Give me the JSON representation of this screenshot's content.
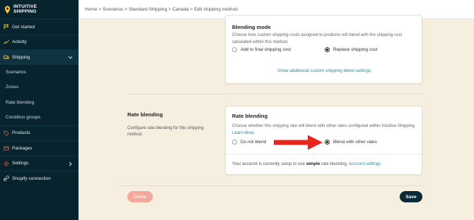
{
  "brand": {
    "line1": "INTUITIVE",
    "line2": "SHIPPING",
    "accent": "#f5c42a"
  },
  "sidebar": {
    "items": [
      {
        "label": "Get started",
        "icon": "flag-icon"
      },
      {
        "label": "Activity",
        "icon": "activity-icon"
      },
      {
        "label": "Shipping",
        "icon": "truck-icon"
      },
      {
        "label": "Scenarios"
      },
      {
        "label": "Zones"
      },
      {
        "label": "Rate blending"
      },
      {
        "label": "Condition groups"
      },
      {
        "label": "Products",
        "icon": "tag-icon"
      },
      {
        "label": "Packages",
        "icon": "box-icon"
      },
      {
        "label": "Settings",
        "icon": "gear-icon"
      },
      {
        "label": "Shopify connection",
        "icon": "link-icon"
      }
    ]
  },
  "breadcrumb": "Home > Scenarios > Standard Shipping > Canada > Edit shipping method",
  "blending_mode": {
    "title": "Blending mode",
    "description": "Choose how custom shipping costs assigned to products will blend with the shipping cost calculated within this method.",
    "options": [
      "Add to final shipping cost",
      "Replace shipping cost"
    ],
    "selected": "Replace shipping cost",
    "link": "Show additional custom shipping blend settings"
  },
  "rate_blending_section": {
    "title": "Rate blending",
    "description": "Configure rate blending for this shipping method."
  },
  "rate_blending_card": {
    "title": "Rate blending",
    "description": "Choose whether this shipping rate will blend with other rates configured within Intuitive Shipping.",
    "learn_more": "Learn More.",
    "options": [
      "Do not blend",
      "Blend with other rates"
    ],
    "selected": "Blend with other rates",
    "footer_prefix": "Your account is currently setup to use",
    "footer_bold": "simple",
    "footer_suffix": "rate blending.",
    "footer_link": "Account settings"
  },
  "buttons": {
    "delete": "Delete",
    "save": "Save"
  },
  "colors": {
    "sidebar_bg": "#07232e",
    "page_bg": "#f6efe0",
    "link": "#2a8aa0",
    "arrow": "#e8241c",
    "save_bg": "#0a2a36",
    "delete_bg": "#f4a79b"
  }
}
